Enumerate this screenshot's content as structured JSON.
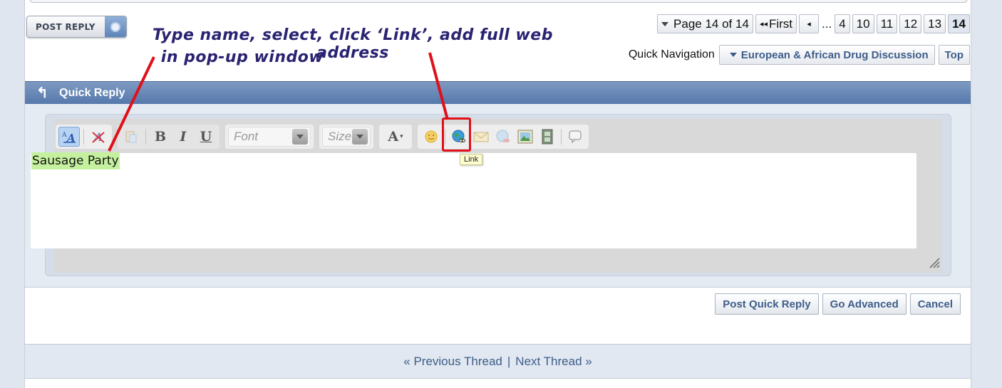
{
  "post_reply": {
    "label": "POST REPLY"
  },
  "annotation": {
    "line1": "Type name, select, click ‘Link’, add full web address",
    "line2": "in pop-up window",
    "color": "#2a2372",
    "highlight_color": "#e0101a"
  },
  "pagination": {
    "page_menu": "Page 14 of 14",
    "first": "First",
    "prev_icon": "chevron-left-icon",
    "ellipsis": "...",
    "pages": [
      "4",
      "10",
      "11",
      "12",
      "13"
    ],
    "current": "14"
  },
  "quick_navigation": {
    "label": "Quick Navigation",
    "forum": "European & African Drug Discussion",
    "top": "Top"
  },
  "quick_reply": {
    "title": "Quick Reply",
    "header_color": "#5f80b1"
  },
  "toolbar": {
    "font_placeholder": "Font",
    "size_placeholder": "Size",
    "bold": "B",
    "italic": "I",
    "underline": "U",
    "text_color": "A",
    "tooltip": "Link"
  },
  "editor": {
    "text": "Sausage Party",
    "selection_color": "#c5f19f"
  },
  "actions": {
    "post_quick_reply": "Post Quick Reply",
    "go_advanced": "Go Advanced",
    "cancel": "Cancel"
  },
  "thread_nav": {
    "previous": "« Previous Thread",
    "separator": "|",
    "next": "Next Thread »"
  }
}
